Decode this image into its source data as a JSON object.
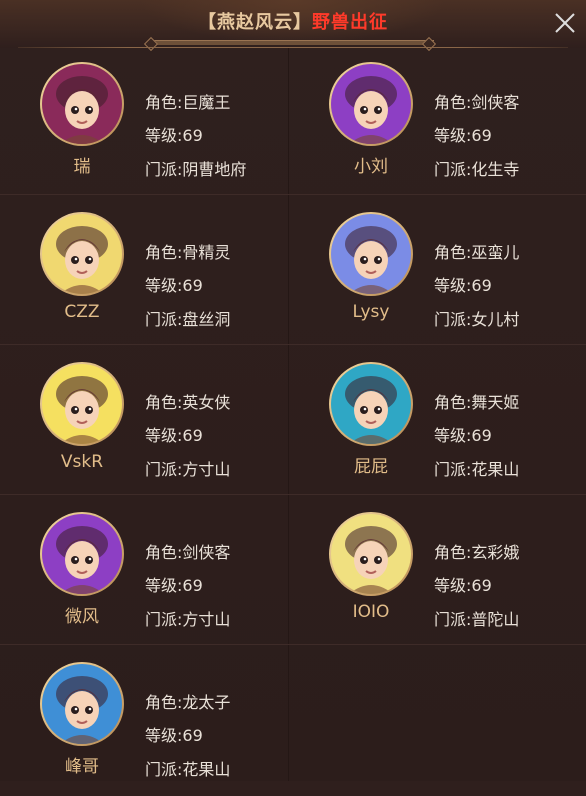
{
  "dialog": {
    "title_group": "【燕赵风云】",
    "title_event": "野兽出征"
  },
  "labels": {
    "role": "角色:",
    "level": "等级:",
    "school": "门派:"
  },
  "players": [
    {
      "name": "瑞",
      "role": "巨魔王",
      "level": "69",
      "school": "阴曹地府",
      "bg": "#8a2a5a"
    },
    {
      "name": "小刘",
      "role": "剑侠客",
      "level": "69",
      "school": "化生寺",
      "bg": "#8d3fc4"
    },
    {
      "name": "CZZ",
      "role": "骨精灵",
      "level": "69",
      "school": "盘丝洞",
      "bg": "#f0d870"
    },
    {
      "name": "Lysy",
      "role": "巫蛮儿",
      "level": "69",
      "school": "女儿村",
      "bg": "#7b8ce6"
    },
    {
      "name": "VskR",
      "role": "英女侠",
      "level": "69",
      "school": "方寸山",
      "bg": "#f5e060"
    },
    {
      "name": "屁屁",
      "role": "舞天姬",
      "level": "69",
      "school": "花果山",
      "bg": "#2fa7c5"
    },
    {
      "name": "微风",
      "role": "剑侠客",
      "level": "69",
      "school": "方寸山",
      "bg": "#8d3fc4"
    },
    {
      "name": "IOIO",
      "role": "玄彩娥",
      "level": "69",
      "school": "普陀山",
      "bg": "#f0e080"
    },
    {
      "name": "峰哥",
      "role": "龙太子",
      "level": "69",
      "school": "花果山",
      "bg": "#3f8fd6"
    }
  ]
}
